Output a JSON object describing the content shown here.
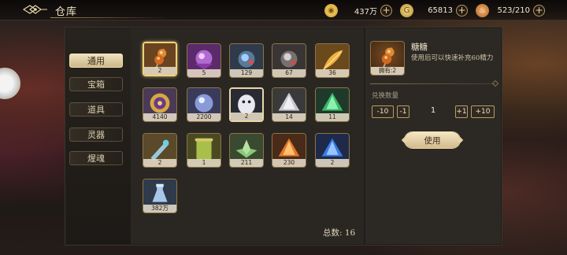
{
  "header": {
    "title": "仓库",
    "resources": [
      {
        "icon": "gold-coin-icon",
        "value": "437万"
      },
      {
        "icon": "silver-coin-icon",
        "value": "65813"
      },
      {
        "icon": "stamina-drumstick-icon",
        "value": "523/210"
      }
    ]
  },
  "sidebar": {
    "tabs": [
      {
        "label": "通用",
        "active": true
      },
      {
        "label": "宝箱",
        "active": false
      },
      {
        "label": "道具",
        "active": false
      },
      {
        "label": "灵器",
        "active": false
      },
      {
        "label": "煋魂",
        "active": false
      }
    ]
  },
  "grid": {
    "items": [
      {
        "icon": "candied-haws-icon",
        "count": "2",
        "selected": true
      },
      {
        "icon": "purple-orb-icon",
        "count": "5"
      },
      {
        "icon": "blue-gem-icon",
        "count": "129"
      },
      {
        "icon": "grey-crystal-icon",
        "count": "67"
      },
      {
        "icon": "golden-feather-icon",
        "count": "36"
      },
      {
        "icon": "gold-medallion-icon",
        "count": "4140"
      },
      {
        "icon": "blue-orb-icon",
        "count": "2200"
      },
      {
        "icon": "white-spirit-icon",
        "count": "2"
      },
      {
        "icon": "silver-shard-icon",
        "count": "14"
      },
      {
        "icon": "green-shard-icon",
        "count": "11"
      },
      {
        "icon": "broken-blade-icon",
        "count": "2"
      },
      {
        "icon": "green-scroll-icon",
        "count": "1"
      },
      {
        "icon": "jade-lotus-icon",
        "count": "211"
      },
      {
        "icon": "orange-shard-icon",
        "count": "230"
      },
      {
        "icon": "blue-shard-icon",
        "count": "2"
      },
      {
        "icon": "crystal-bottle-icon",
        "count": "382万"
      }
    ],
    "total_label": "总数: 16"
  },
  "detail": {
    "name": "糖糖",
    "description": "使用后可以快速补充60精力",
    "owned": "拥有:2",
    "quantity_label": "兑换数量",
    "buttons": {
      "minus10": "-10",
      "minus1": "-1",
      "plus1": "+1",
      "plus10": "+10"
    },
    "quantity": "1",
    "use_label": "使用"
  },
  "colors": {
    "accent": "#f0d27a",
    "active_tab": "#e6d4a8",
    "slot_border": "#8d7445"
  }
}
